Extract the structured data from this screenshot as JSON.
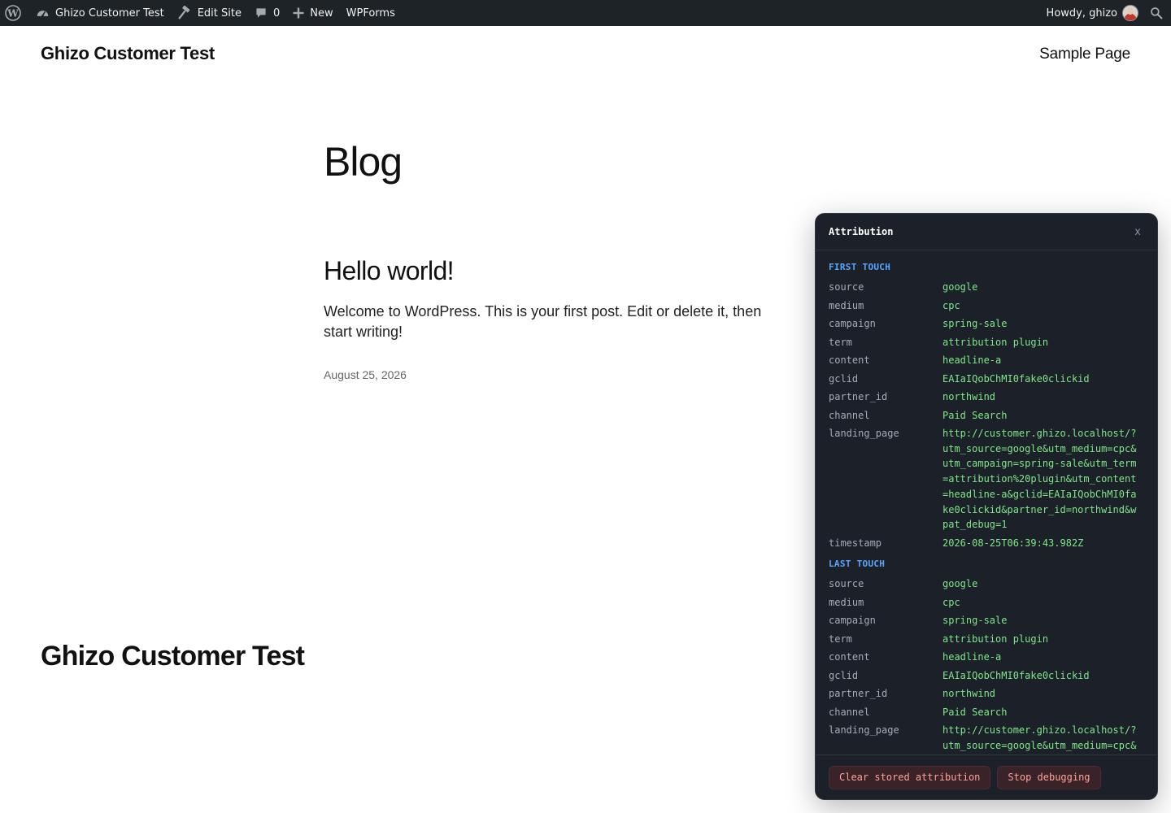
{
  "admin_bar": {
    "site_name": "Ghizo Customer Test",
    "edit_site": "Edit Site",
    "comments_count": "0",
    "new_label": "New",
    "wpforms": "WPForms",
    "howdy": "Howdy, ghizo"
  },
  "header": {
    "site_title": "Ghizo Customer Test",
    "nav": [
      "Sample Page"
    ]
  },
  "main": {
    "heading": "Blog",
    "post": {
      "title": "Hello world!",
      "excerpt": "Welcome to WordPress. This is your first post. Edit or delete it, then start writing!",
      "date": "August 25, 2026"
    }
  },
  "footer": {
    "site_title": "Ghizo Customer Test"
  },
  "panel": {
    "title": "Attribution",
    "close": "x",
    "first_touch": {
      "label": "FIRST TOUCH",
      "rows": [
        {
          "key": "source",
          "value": "google"
        },
        {
          "key": "medium",
          "value": "cpc"
        },
        {
          "key": "campaign",
          "value": "spring-sale"
        },
        {
          "key": "term",
          "value": "attribution plugin"
        },
        {
          "key": "content",
          "value": "headline-a"
        },
        {
          "key": "gclid",
          "value": "EAIaIQobChMI0fake0clickid"
        },
        {
          "key": "partner_id",
          "value": "northwind"
        },
        {
          "key": "channel",
          "value": "Paid Search"
        },
        {
          "key": "landing_page",
          "value": "http://customer.ghizo.localhost/?utm_source=google&utm_medium=cpc&utm_campaign=spring-sale&utm_term=attribution%20plugin&utm_content=headline-a&gclid=EAIaIQobChMI0fake0clickid&partner_id=northwind&wpat_debug=1"
        },
        {
          "key": "timestamp",
          "value": "2026-08-25T06:39:43.982Z"
        }
      ]
    },
    "last_touch": {
      "label": "LAST TOUCH",
      "rows": [
        {
          "key": "source",
          "value": "google"
        },
        {
          "key": "medium",
          "value": "cpc"
        },
        {
          "key": "campaign",
          "value": "spring-sale"
        },
        {
          "key": "term",
          "value": "attribution plugin"
        },
        {
          "key": "content",
          "value": "headline-a"
        },
        {
          "key": "gclid",
          "value": "EAIaIQobChMI0fake0clickid"
        },
        {
          "key": "partner_id",
          "value": "northwind"
        },
        {
          "key": "channel",
          "value": "Paid Search"
        },
        {
          "key": "landing_page",
          "value": "http://customer.ghizo.localhost/?utm_source=google&utm_medium=cpc&u"
        }
      ]
    },
    "buttons": {
      "clear": "Clear stored attribution",
      "stop": "Stop debugging"
    }
  },
  "colors": {
    "admin_bar_bg": "#1d2327",
    "panel_bg": "#1c2129",
    "section_label": "#58a6ff",
    "value_green": "#7ee787",
    "button_text": "#ffa198"
  }
}
